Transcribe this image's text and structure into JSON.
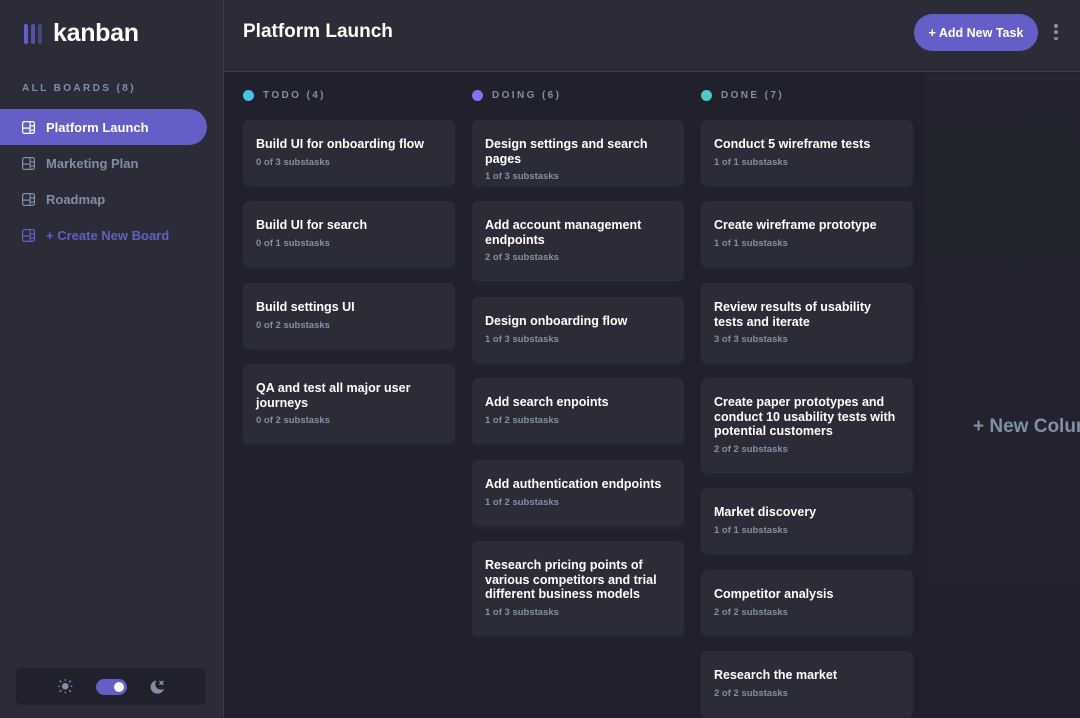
{
  "app": {
    "name": "kanban"
  },
  "sidebar": {
    "boards_heading": "ALL BOARDS (8)",
    "boards": [
      {
        "label": "Platform Launch",
        "active": true
      },
      {
        "label": "Marketing Plan",
        "active": false
      },
      {
        "label": "Roadmap",
        "active": false
      }
    ],
    "create_board_label": "+ Create New Board",
    "theme": {
      "light_icon": "sun-icon",
      "dark_icon": "moon-icon",
      "dark_mode": true
    }
  },
  "header": {
    "title": "Platform Launch",
    "add_task_label": "+ Add New Task",
    "menu_icon": "vertical-ellipsis-icon"
  },
  "colors": {
    "accent": "#635fc7",
    "todo": "#49c4e5",
    "doing": "#8471f2",
    "done": "#67e2ae"
  },
  "columns": [
    {
      "title": "TODO (4)",
      "dot_color": "#49c4e5",
      "tasks": [
        {
          "title": "Build UI for onboarding flow",
          "subtasks": "0 of 3 substasks"
        },
        {
          "title": "Build UI for search",
          "subtasks": "0 of 1 substasks"
        },
        {
          "title": "Build settings UI",
          "subtasks": "0 of 2 substasks"
        },
        {
          "title": "QA and test all major user journeys",
          "subtasks": "0 of 2 substasks"
        }
      ]
    },
    {
      "title": "DOING (6)",
      "dot_color": "#8471f2",
      "tasks": [
        {
          "title": "Design settings and search pages",
          "subtasks": "1 of 3 substasks"
        },
        {
          "title": "Add account management endpoints",
          "subtasks": "2 of 3 substasks"
        },
        {
          "title": "Design onboarding flow",
          "subtasks": "1 of 3 substasks"
        },
        {
          "title": "Add search enpoints",
          "subtasks": "1 of 2 substasks"
        },
        {
          "title": "Add authentication endpoints",
          "subtasks": "1 of 2 substasks"
        },
        {
          "title": "Research pricing points of various competitors and trial different business models",
          "subtasks": "1 of 3 substasks"
        }
      ]
    },
    {
      "title": "DONE (7)",
      "dot_color": "#4fc9c2",
      "tasks": [
        {
          "title": "Conduct 5 wireframe tests",
          "subtasks": "1 of 1 substasks"
        },
        {
          "title": "Create wireframe prototype",
          "subtasks": "1 of 1 substasks"
        },
        {
          "title": "Review results of usability tests and iterate",
          "subtasks": "3 of 3 substasks"
        },
        {
          "title": "Create paper prototypes and conduct 10 usability tests with potential customers",
          "subtasks": "2 of 2 substasks"
        },
        {
          "title": "Market discovery",
          "subtasks": "1 of 1 substasks"
        },
        {
          "title": "Competitor analysis",
          "subtasks": "2 of 2 substasks"
        },
        {
          "title": "Research the market",
          "subtasks": "2 of 2 substasks"
        }
      ]
    }
  ],
  "new_column_label": "+ New Column"
}
